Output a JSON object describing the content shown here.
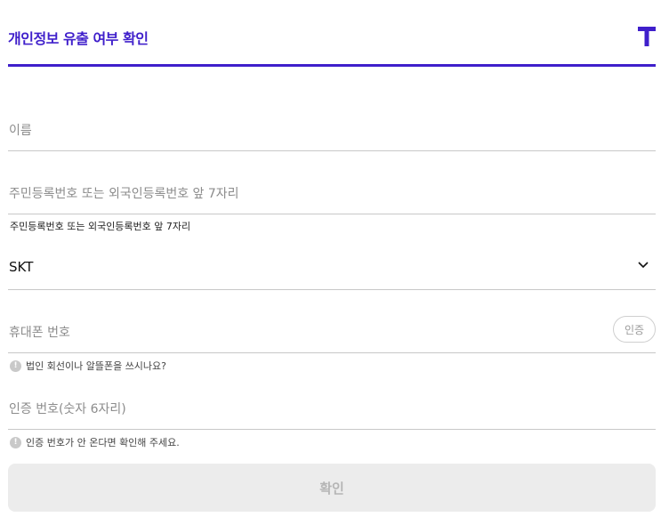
{
  "header": {
    "title": "개인정보 유출 여부 확인",
    "logo_icon": "tmap-t-logo-icon",
    "accent_color": "#3f1fcb"
  },
  "form": {
    "name": {
      "placeholder": "이름"
    },
    "id_number": {
      "placeholder": "주민등록번호 또는 외국인등록번호 앞 7자리",
      "hint": "주민등록번호 또는 외국인등록번호 앞 7자리"
    },
    "carrier": {
      "value": "SKT",
      "icon": "chevron-down-icon"
    },
    "phone": {
      "placeholder": "휴대폰 번호",
      "verify_label": "인증",
      "help": "법인 회선이나 알뜰폰을 쓰시나요?",
      "help_icon": "info-icon"
    },
    "auth_code": {
      "placeholder": "인증 번호(숫자 6자리)",
      "help": "인증 번호가 안 온다면 확인해 주세요.",
      "help_icon": "info-icon"
    }
  },
  "confirm_button": {
    "label": "확인"
  }
}
